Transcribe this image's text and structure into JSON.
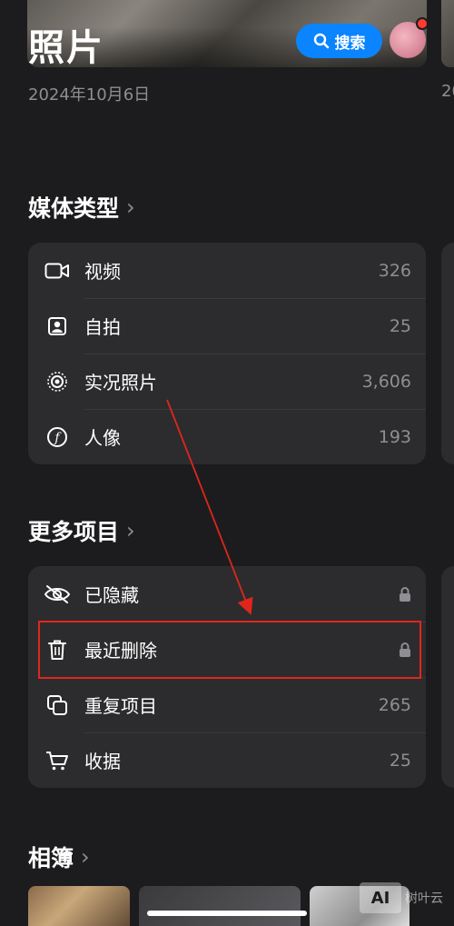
{
  "header": {
    "title": "照片",
    "search_label": "搜索",
    "date": "2024年10月6日",
    "date_next": "20"
  },
  "media_types": {
    "title": "媒体类型",
    "items": [
      {
        "label": "视频",
        "count": "326",
        "icon": "video-icon"
      },
      {
        "label": "自拍",
        "count": "25",
        "icon": "selfie-icon"
      },
      {
        "label": "实况照片",
        "count": "3,606",
        "icon": "live-photo-icon"
      },
      {
        "label": "人像",
        "count": "193",
        "icon": "portrait-icon"
      }
    ]
  },
  "more_items": {
    "title": "更多项目",
    "items": [
      {
        "label": "已隐藏",
        "icon": "hidden-eye-icon",
        "locked": true
      },
      {
        "label": "最近删除",
        "icon": "trash-icon",
        "locked": true
      },
      {
        "label": "重复项目",
        "count": "265",
        "icon": "duplicate-icon"
      },
      {
        "label": "收据",
        "count": "25",
        "icon": "cart-icon"
      }
    ]
  },
  "albums": {
    "title": "相簿"
  },
  "watermark": {
    "logo": "AI",
    "text": "树叶云"
  },
  "colors": {
    "background": "#1c1c1e",
    "card": "#2c2c2e",
    "accent": "#0a84ff",
    "annotation": "#e0261c",
    "secondary_text": "#8e8e93"
  }
}
